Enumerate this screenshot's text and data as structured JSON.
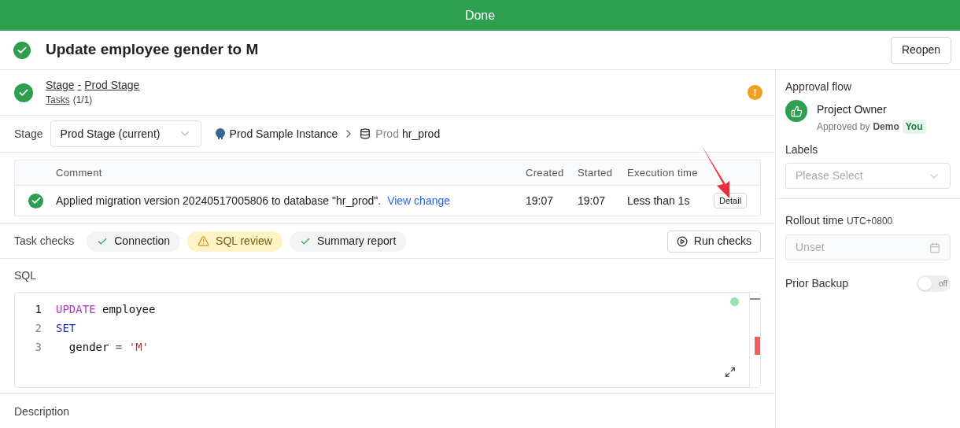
{
  "banner": {
    "label": "Done"
  },
  "header": {
    "title": "Update employee gender to M",
    "completed": true,
    "action": "Reopen"
  },
  "stage": {
    "completed": true,
    "name_prefix": "Stage",
    "separator": "-",
    "name": "Prod Stage",
    "tasks_link": "Tasks",
    "tasks_count": "(1/1)",
    "warning_mark": "!"
  },
  "stage_selector": {
    "label": "Stage",
    "value": "Prod Stage (current)",
    "instance": "Prod Sample Instance",
    "environment": "Prod",
    "database": "hr_prod"
  },
  "task_table": {
    "columns": [
      "Comment",
      "Created",
      "Started",
      "Execution time"
    ],
    "rows": [
      {
        "completed": true,
        "comment": "Applied migration version 20240517005806 to database \"hr_prod\".",
        "link": "View change",
        "created": "19:07",
        "started": "19:07",
        "execution_time": "Less than 1s",
        "action": "Detail"
      }
    ]
  },
  "task_checks": {
    "label": "Task checks",
    "items": [
      {
        "label": "Connection",
        "warning": false
      },
      {
        "label": "SQL review",
        "warning": true
      },
      {
        "label": "Summary report",
        "warning": false
      }
    ],
    "action": "Run checks"
  },
  "sql": {
    "label": "SQL",
    "lines": [
      {
        "number": "1",
        "tokens": [
          {
            "kind": "keyword",
            "text": "UPDATE"
          },
          {
            "kind": "plain",
            "text": " employee"
          }
        ]
      },
      {
        "number": "2",
        "tokens": [
          {
            "kind": "keyword2",
            "text": "SET"
          }
        ]
      },
      {
        "number": "3",
        "tokens": [
          {
            "kind": "plain",
            "text": "  gender "
          },
          {
            "kind": "operator",
            "text": "= "
          },
          {
            "kind": "string",
            "text": "'M'"
          }
        ]
      }
    ]
  },
  "description": {
    "label": "Description"
  },
  "sidebar": {
    "approval_title": "Approval flow",
    "approver": {
      "role": "Project Owner",
      "approved_by": "Approved by",
      "name": "Demo",
      "tag": "You"
    },
    "labels_title": "Labels",
    "labels_placeholder": "Please Select",
    "rollout_title": "Rollout time",
    "rollout_timezone": "UTC+0800",
    "rollout_placeholder": "Unset",
    "backup_title": "Prior Backup",
    "backup": {
      "on": false,
      "label": "off"
    }
  }
}
